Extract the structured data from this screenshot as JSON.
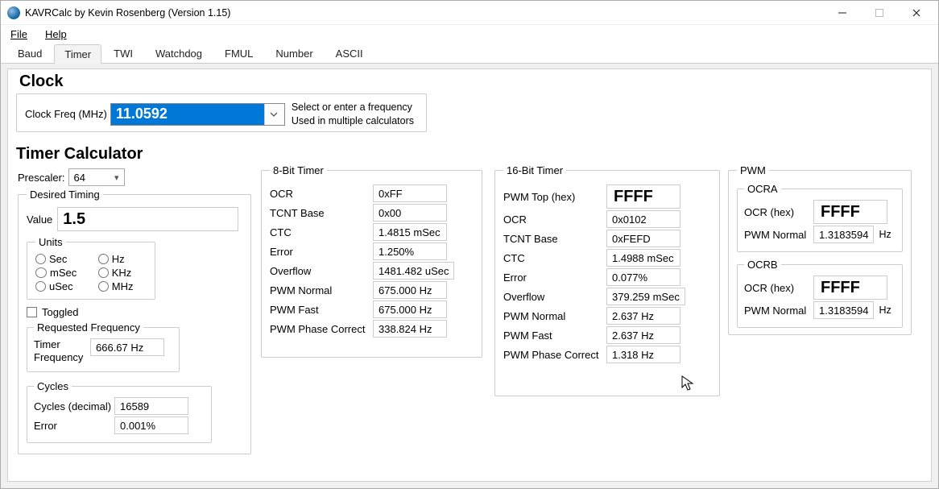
{
  "window": {
    "title": "KAVRCalc by Kevin Rosenberg (Version 1.15)"
  },
  "menu": {
    "file": "File",
    "help": "Help"
  },
  "tabs": [
    "Baud",
    "Timer",
    "TWI",
    "Watchdog",
    "FMUL",
    "Number",
    "ASCII"
  ],
  "active_tab": "Timer",
  "clock": {
    "heading": "Clock",
    "freq_label": "Clock Freq (MHz)",
    "freq_value": "11.0592",
    "help1": "Select or enter a frequency",
    "help2": "Used in multiple calculators"
  },
  "timer_heading": "Timer Calculator",
  "prescaler": {
    "label": "Prescaler:",
    "value": "64"
  },
  "desired": {
    "legend": "Desired Timing",
    "value_label": "Value",
    "value": "1.5",
    "units_legend": "Units",
    "units": {
      "sec": "Sec",
      "msec": "mSec",
      "usec": "uSec",
      "hz": "Hz",
      "khz": "KHz",
      "mhz": "MHz"
    },
    "selected_unit": "mSec",
    "toggled": "Toggled",
    "req_legend": "Requested Frequency",
    "req_label": "Timer Frequency",
    "req_value": "666.67 Hz",
    "cycles_legend": "Cycles",
    "cycles_label": "Cycles (decimal)",
    "cycles_value": "16589",
    "cycles_err_label": "Error",
    "cycles_err_value": "0.001%"
  },
  "t8": {
    "legend": "8-Bit Timer",
    "ocr_label": "OCR",
    "ocr": "0xFF",
    "tcnt_label": "TCNT Base",
    "tcnt": "0x00",
    "ctc_label": "CTC",
    "ctc": "1.4815 mSec",
    "err_label": "Error",
    "err": "1.250%",
    "ovf_label": "Overflow",
    "ovf": "1481.482 uSec",
    "pwmn_label": "PWM Normal",
    "pwmn": "675.000 Hz",
    "pwmf_label": "PWM Fast",
    "pwmf": "675.000 Hz",
    "pwmp_label": "PWM Phase Correct",
    "pwmp": "338.824 Hz"
  },
  "t16": {
    "legend": "16-Bit Timer",
    "top_label": "PWM Top (hex)",
    "top": "FFFF",
    "ocr_label": "OCR",
    "ocr": "0x0102",
    "tcnt_label": "TCNT Base",
    "tcnt": "0xFEFD",
    "ctc_label": "CTC",
    "ctc": "1.4988 mSec",
    "err_label": "Error",
    "err": "0.077%",
    "ovf_label": "Overflow",
    "ovf": "379.259 mSec",
    "pwmn_label": "PWM Normal",
    "pwmn": "2.637 Hz",
    "pwmf_label": "PWM Fast",
    "pwmf": "2.637 Hz",
    "pwmp_label": "PWM Phase Correct",
    "pwmp": "1.318 Hz"
  },
  "pwm": {
    "legend": "PWM",
    "ocra_legend": "OCRA",
    "ocra_hex_label": "OCR (hex)",
    "ocra_hex": "FFFF",
    "ocra_n_label": "PWM Normal",
    "ocra_n": "1.3183594",
    "ocra_n_unit": "Hz",
    "ocrb_legend": "OCRB",
    "ocrb_hex_label": "OCR (hex)",
    "ocrb_hex": "FFFF",
    "ocrb_n_label": "PWM Normal",
    "ocrb_n": "1.3183594",
    "ocrb_n_unit": "Hz"
  }
}
